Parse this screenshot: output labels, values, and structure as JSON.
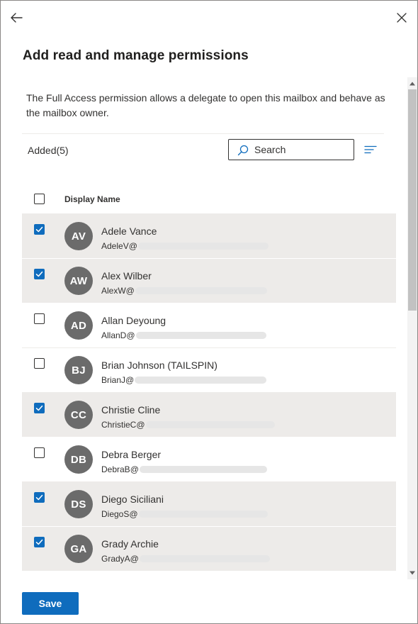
{
  "panel": {
    "title": "Add read and manage permissions",
    "description": "The Full Access permission allows a delegate to open this mailbox and behave as the mailbox owner."
  },
  "toolbar": {
    "added_label": "Added(5)",
    "search_placeholder": "Search"
  },
  "table": {
    "column_header": "Display Name",
    "header_checked": false,
    "rows": [
      {
        "initials": "AV",
        "name": "Adele Vance",
        "email_prefix": "AdeleV@",
        "checked": true
      },
      {
        "initials": "AW",
        "name": "Alex Wilber",
        "email_prefix": "AlexW@",
        "checked": true
      },
      {
        "initials": "AD",
        "name": "Allan Deyoung",
        "email_prefix": "AllanD@",
        "checked": false
      },
      {
        "initials": "BJ",
        "name": "Brian Johnson (TAILSPIN)",
        "email_prefix": "BrianJ@",
        "checked": false
      },
      {
        "initials": "CC",
        "name": "Christie Cline",
        "email_prefix": "ChristieC@",
        "checked": true
      },
      {
        "initials": "DB",
        "name": "Debra Berger",
        "email_prefix": "DebraB@",
        "checked": false
      },
      {
        "initials": "DS",
        "name": "Diego Siciliani",
        "email_prefix": "DiegoS@",
        "checked": true
      },
      {
        "initials": "GA",
        "name": "Grady Archie",
        "email_prefix": "GradyA@",
        "checked": true
      }
    ]
  },
  "footer": {
    "save_label": "Save"
  },
  "colors": {
    "accent": "#0f6cbd",
    "avatar": "#6b6b6b",
    "selected_row": "#edebe9"
  },
  "icons": {
    "back": "arrow-left-icon",
    "close": "close-icon",
    "search": "search-icon",
    "sort": "sort-lines-icon",
    "check": "checkmark-icon"
  }
}
